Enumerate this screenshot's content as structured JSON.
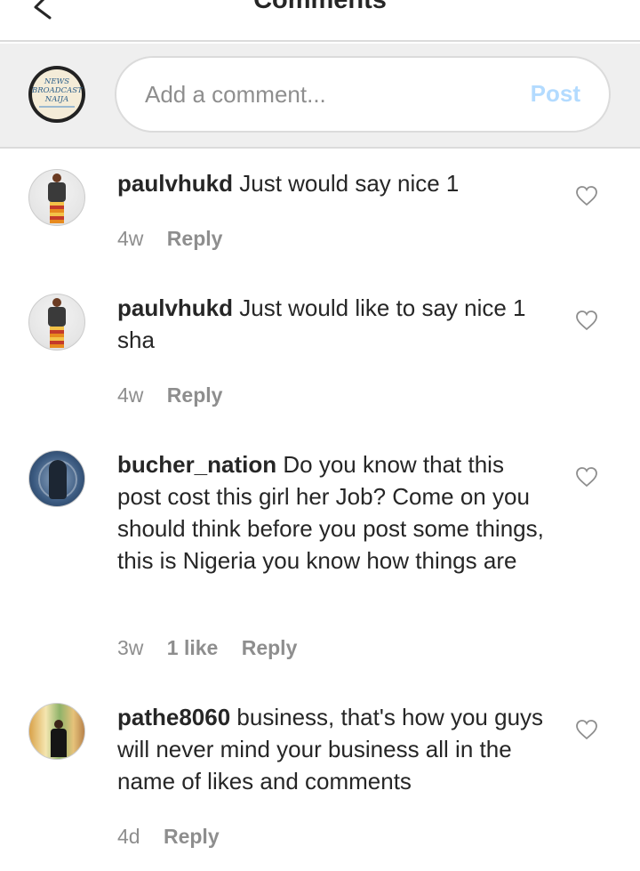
{
  "header": {
    "title": "Comments"
  },
  "composer": {
    "avatar_lines": [
      "NEWS",
      "BROADCAST",
      "NAIJA"
    ],
    "placeholder": "Add a comment...",
    "post_label": "Post"
  },
  "comments": [
    {
      "username": "paulvhukd",
      "text": "Just would say nice 1",
      "time": "4w",
      "likes": "",
      "reply_label": "Reply"
    },
    {
      "username": "paulvhukd",
      "text": "Just would like to say nice 1 sha",
      "time": "4w",
      "likes": "",
      "reply_label": "Reply"
    },
    {
      "username": "bucher_nation",
      "text": "Do you know that this post cost this girl her Job? Come on you should think before you post some things, this is Nigeria you know how things are",
      "time": "3w",
      "likes": "1 like",
      "reply_label": "Reply"
    },
    {
      "username": "pathe8060",
      "text": "business, that's how you guys will never mind your business all in the name of likes and comments",
      "time": "4d",
      "likes": "",
      "reply_label": "Reply"
    }
  ],
  "icons": {
    "back": "arrow-left-icon",
    "like": "heart-outline-icon"
  },
  "colors": {
    "post_disabled": "#b3dbff",
    "meta_gray": "#8e8e8e",
    "divider": "#dbdbdb",
    "composer_bg": "#efefef"
  }
}
